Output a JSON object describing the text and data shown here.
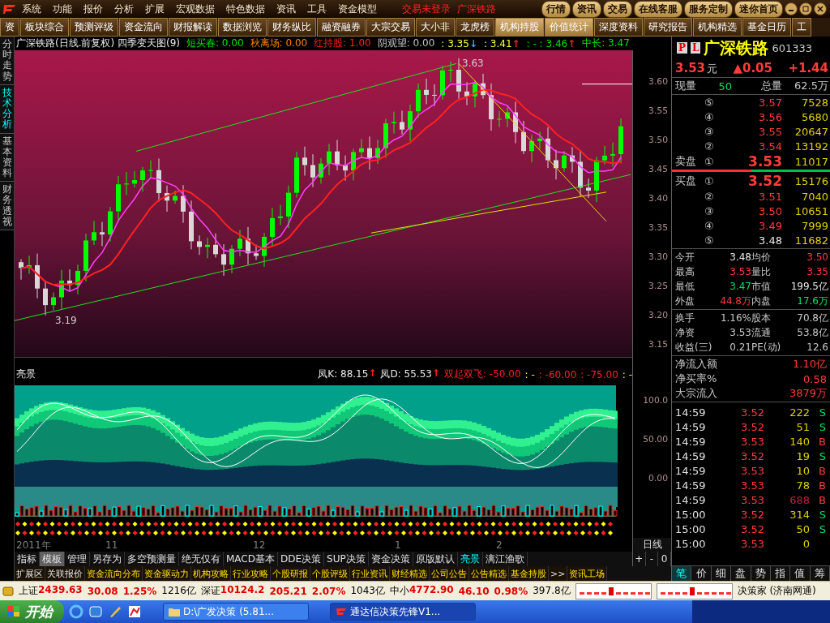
{
  "menu": {
    "items": [
      "系统",
      "功能",
      "报价",
      "分析",
      "扩展",
      "宏观数据",
      "特色数据",
      "资讯",
      "工具",
      "资金模型"
    ],
    "status": "交易未登录",
    "stock": "广深铁路",
    "buttons": [
      "行情",
      "资讯",
      "交易",
      "在线客服",
      "服务定制",
      "迷你首页"
    ]
  },
  "toolbar": [
    {
      "label": "资",
      "selected": false
    },
    {
      "label": "板块综合",
      "selected": false
    },
    {
      "label": "预测评级",
      "selected": false
    },
    {
      "label": "资金流向",
      "selected": false
    },
    {
      "label": "财报解读",
      "selected": false
    },
    {
      "label": "数据浏览",
      "selected": false
    },
    {
      "label": "财务纵比",
      "selected": false
    },
    {
      "label": "融资融券",
      "selected": false
    },
    {
      "label": "大宗交易",
      "selected": false
    },
    {
      "label": "大小非",
      "selected": false
    },
    {
      "label": "龙虎榜",
      "selected": false
    },
    {
      "label": "机构持股",
      "selected": true
    },
    {
      "label": "价值统计",
      "selected": true
    },
    {
      "label": "深度资料",
      "selected": false
    },
    {
      "label": "研究报告",
      "selected": false
    },
    {
      "label": "机构精选",
      "selected": false
    },
    {
      "label": "基金日历",
      "selected": false
    },
    {
      "label": "工",
      "selected": false
    }
  ],
  "side_tabs": [
    {
      "label": "分时走势",
      "selected": false
    },
    {
      "label": "技术分析",
      "selected": true
    },
    {
      "label": "基本资料",
      "selected": false
    },
    {
      "label": "财务透视",
      "selected": false
    }
  ],
  "chart_header": {
    "title": "广深铁路(日线.前复权) 四季变天图(9)",
    "items": [
      {
        "text": "短买春: 0.00",
        "kind": "buy"
      },
      {
        "text": "秋离场: 0.00",
        "kind": "exit"
      },
      {
        "text": "红持股: 1.00",
        "kind": "hold"
      },
      {
        "text": "阴观望: 0.00",
        "kind": "watch"
      },
      {
        "text": ": 3.35",
        "kind": "line",
        "arrow": "↓"
      },
      {
        "text": ": 3.41",
        "kind": "line",
        "arrow": "↑"
      },
      {
        "text": ": - : 3.46",
        "kind": "long",
        "arrow": "↑"
      },
      {
        "text": "中长: 3.47",
        "kind": "long"
      }
    ]
  },
  "price_axis": [
    "3.60",
    "3.55",
    "3.50",
    "3.45",
    "3.40",
    "3.35",
    "3.30",
    "3.25",
    "3.20",
    "3.15"
  ],
  "chart_labels": [
    "3.63",
    "3.19"
  ],
  "indicator": {
    "name": "亮景",
    "items": [
      {
        "text": "凤K: 88.15",
        "kind": "value",
        "arrow": "↑"
      },
      {
        "text": "凤D: 55.53",
        "kind": "value",
        "arrow": "↑"
      },
      {
        "text": "双起双飞: -50.00",
        "kind": "signal"
      },
      {
        "text": ": -",
        "kind": "separator"
      },
      {
        "text": ": -60.00",
        "kind": "signal"
      },
      {
        "text": ": -75.00",
        "kind": "signal"
      },
      {
        "text": ": -",
        "kind": "separator"
      }
    ],
    "axis": [
      "100.0",
      "50.00",
      "0.00"
    ]
  },
  "date_axis": [
    "2011年",
    "11",
    "12",
    "1",
    "2"
  ],
  "period": "日线",
  "zoom_buttons": [
    "+",
    "-",
    "0"
  ],
  "indicator_tabs": [
    {
      "label": "指标",
      "selected": false,
      "pressed": false
    },
    {
      "label": "模板",
      "selected": false,
      "pressed": true
    },
    {
      "label": "管理",
      "selected": false,
      "pressed": false
    },
    {
      "label": "另存为",
      "selected": false,
      "pressed": false
    },
    {
      "label": "多空预测量",
      "selected": false,
      "pressed": false
    },
    {
      "label": "绝无仅有",
      "selected": false,
      "pressed": false
    },
    {
      "label": "MACD基本",
      "selected": false,
      "pressed": false
    },
    {
      "label": "DDE决策",
      "selected": false,
      "pressed": false
    },
    {
      "label": "SUP决策",
      "selected": false,
      "pressed": false
    },
    {
      "label": "资金决策",
      "selected": false,
      "pressed": false
    },
    {
      "label": "原版默认",
      "selected": false,
      "pressed": false
    },
    {
      "label": "亮景",
      "selected": true,
      "pressed": false
    },
    {
      "label": "漓江渔歌",
      "selected": false,
      "pressed": false
    }
  ],
  "info_tabs": [
    {
      "label": "扩展区",
      "kind": "section"
    },
    {
      "label": "关联报价",
      "kind": "section"
    },
    {
      "label": "资金流向分布",
      "kind": "link"
    },
    {
      "label": "资金驱动力",
      "kind": "link"
    },
    {
      "label": "机构攻略",
      "kind": "link"
    },
    {
      "label": "行业攻略",
      "kind": "link"
    },
    {
      "label": "个股研报",
      "kind": "link"
    },
    {
      "label": "个股评级",
      "kind": "link"
    },
    {
      "label": "行业资讯",
      "kind": "link"
    },
    {
      "label": "财经精选",
      "kind": "link"
    },
    {
      "label": "公司公告",
      "kind": "link"
    },
    {
      "label": "公告精选",
      "kind": "link"
    },
    {
      "label": "基金持股",
      "kind": "link"
    },
    {
      "label": ">>",
      "kind": "section"
    },
    {
      "label": "资讯工场",
      "kind": "link"
    }
  ],
  "quote": {
    "badges": [
      "P",
      "L"
    ],
    "name": "广深铁路",
    "code": "601333",
    "price": "3.53",
    "unit": "元",
    "change": "▲0.05",
    "percent": "+1.44",
    "volume_label": "现量",
    "volume": "50",
    "total_label": "总量",
    "total": "62.5万"
  },
  "asks": [
    {
      "rank": "⑤",
      "price": "3.57",
      "volume": "7528",
      "kind": "up"
    },
    {
      "rank": "④",
      "price": "3.56",
      "volume": "5680",
      "kind": "up"
    },
    {
      "rank": "③",
      "price": "3.55",
      "volume": "20647",
      "kind": "up"
    },
    {
      "rank": "②",
      "price": "3.54",
      "volume": "13192",
      "kind": "up"
    },
    {
      "side": "卖盘",
      "rank": "①",
      "price": "3.53",
      "volume": "11017",
      "kind": "up"
    }
  ],
  "bids": [
    {
      "side": "买盘",
      "rank": "①",
      "price": "3.52",
      "volume": "15176",
      "kind": "up"
    },
    {
      "rank": "②",
      "price": "3.51",
      "volume": "7040",
      "kind": "up"
    },
    {
      "rank": "③",
      "price": "3.50",
      "volume": "10651",
      "kind": "up"
    },
    {
      "rank": "④",
      "price": "3.49",
      "volume": "7999",
      "kind": "up"
    },
    {
      "rank": "⑤",
      "price": "3.48",
      "volume": "11682",
      "kind": "flat"
    }
  ],
  "stats": [
    {
      "label": "今开",
      "value": "3.48",
      "kind": "flat"
    },
    {
      "label": "均价",
      "value": "3.50",
      "kind": "up"
    },
    {
      "label": "最高",
      "value": "3.53",
      "kind": "up"
    },
    {
      "label": "量比",
      "value": "3.35",
      "kind": "up"
    },
    {
      "label": "最低",
      "value": "3.47",
      "kind": "down"
    },
    {
      "label": "市值",
      "value": "199.5亿",
      "kind": "flat"
    },
    {
      "label": "外盘",
      "value": "44.8万",
      "kind": "up"
    },
    {
      "label": "内盘",
      "value": "17.6万",
      "kind": "down"
    }
  ],
  "finance": [
    {
      "label": "换手",
      "value": "1.16%"
    },
    {
      "label": "股本",
      "value": "70.8亿"
    },
    {
      "label": "净资",
      "value": "3.53"
    },
    {
      "label": "流通",
      "value": "53.8亿"
    },
    {
      "label": "收益(三)",
      "value": "0.21"
    },
    {
      "label": "PE(动)",
      "value": "12.6"
    }
  ],
  "flow": [
    {
      "label": "净流入额",
      "value": "1.10亿"
    },
    {
      "label": "净买率%",
      "value": "0.58"
    },
    {
      "label": "大宗流入",
      "value": "3879万"
    }
  ],
  "ticks": [
    {
      "time": "14:59",
      "price": "3.52",
      "volume": "222",
      "side": "S",
      "large": false
    },
    {
      "time": "14:59",
      "price": "3.52",
      "volume": "51",
      "side": "S",
      "large": false
    },
    {
      "time": "14:59",
      "price": "3.53",
      "volume": "140",
      "side": "B",
      "large": false
    },
    {
      "time": "14:59",
      "price": "3.52",
      "volume": "19",
      "side": "S",
      "large": false
    },
    {
      "time": "14:59",
      "price": "3.53",
      "volume": "10",
      "side": "B",
      "large": false
    },
    {
      "time": "14:59",
      "price": "3.53",
      "volume": "78",
      "side": "B",
      "large": false
    },
    {
      "time": "14:59",
      "price": "3.53",
      "volume": "688",
      "side": "B",
      "large": true
    },
    {
      "time": "15:00",
      "price": "3.52",
      "volume": "314",
      "side": "S",
      "large": false
    },
    {
      "time": "15:00",
      "price": "3.52",
      "volume": "50",
      "side": "S",
      "large": false
    },
    {
      "time": "15:00",
      "price": "3.53",
      "volume": "0",
      "large": false
    }
  ],
  "panel_tabs": [
    {
      "label": "笔",
      "selected": true
    },
    {
      "label": "价",
      "selected": false
    },
    {
      "label": "细",
      "selected": false
    },
    {
      "label": "盘",
      "selected": false
    },
    {
      "label": "势",
      "selected": false
    },
    {
      "label": "指",
      "selected": false
    },
    {
      "label": "值",
      "selected": false
    },
    {
      "label": "筹",
      "selected": false
    }
  ],
  "indices": [
    {
      "name": "上证",
      "value": "2439.63",
      "change": "30.08",
      "percent": "1.25%",
      "amount": "1216亿"
    },
    {
      "name": "深证",
      "value": "10124.2",
      "change": "205.21",
      "percent": "2.07%",
      "amount": "1043亿"
    },
    {
      "name": "中小",
      "value": "4772.90",
      "change": "46.10",
      "percent": "0.98%",
      "amount": "397.8亿"
    }
  ],
  "connection": "决策家 (济南网通)",
  "taskbar": {
    "start": "开始",
    "tasks": [
      {
        "label": "D:\\广发决策 (5.81...",
        "selected": false
      },
      {
        "label": "通达信决策先锋V1...",
        "selected": true
      }
    ]
  }
}
